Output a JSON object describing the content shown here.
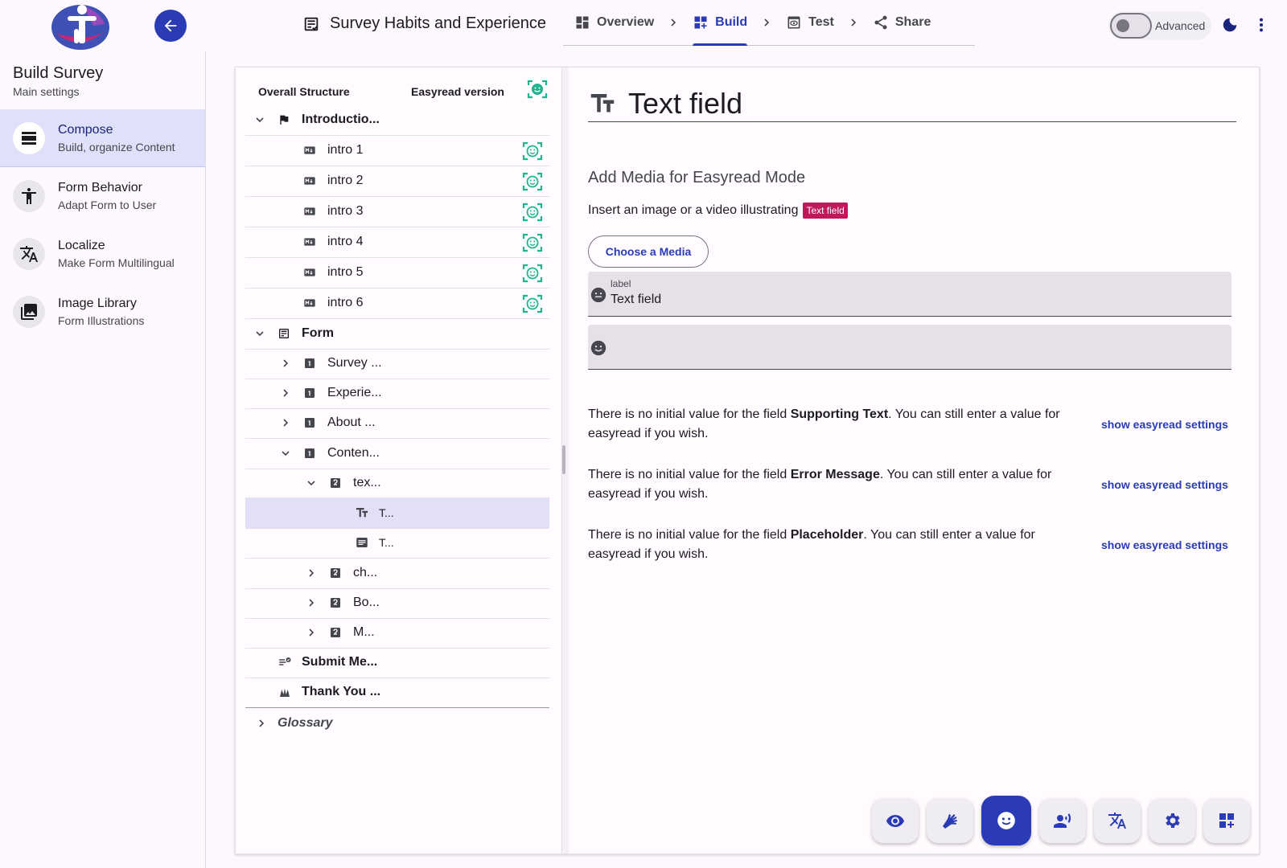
{
  "header": {
    "app_title": "Survey Habits and Experience",
    "steps": [
      {
        "label": "Overview",
        "icon": "dashboard-icon"
      },
      {
        "label": "Build",
        "icon": "build-grid-icon"
      },
      {
        "label": "Test",
        "icon": "preview-icon"
      },
      {
        "label": "Share",
        "icon": "share-icon"
      }
    ],
    "active_step": "Build",
    "advanced_label": "Advanced",
    "advanced_on": false
  },
  "sidebar": {
    "title": "Build Survey",
    "subtitle": "Main settings",
    "items": [
      {
        "label": "Compose",
        "desc": "Build, organize Content",
        "icon": "compose-icon",
        "active": true
      },
      {
        "label": "Form Behavior",
        "desc": "Adapt Form to User",
        "icon": "accessibility-icon",
        "active": false
      },
      {
        "label": "Localize",
        "desc": "Make Form Multilingual",
        "icon": "translate-icon",
        "active": false
      },
      {
        "label": "Image Library",
        "desc": "Form Illustrations",
        "icon": "image-library-icon",
        "active": false
      }
    ]
  },
  "tree": {
    "head_structure": "Overall Structure",
    "head_easyread": "Easyread version",
    "rows": [
      {
        "label": "Introductio...",
        "expander": "open",
        "icon": "flag-icon",
        "bold": true,
        "easyread": false
      },
      {
        "label": "intro 1",
        "expander": "none",
        "icon": "markdown-icon",
        "bold": false,
        "easyread": true
      },
      {
        "label": "intro 2",
        "expander": "none",
        "icon": "markdown-icon",
        "bold": false,
        "easyread": true
      },
      {
        "label": "intro 3",
        "expander": "none",
        "icon": "markdown-icon",
        "bold": false,
        "easyread": true
      },
      {
        "label": "intro 4",
        "expander": "none",
        "icon": "markdown-icon",
        "bold": false,
        "easyread": true
      },
      {
        "label": "intro 5",
        "expander": "none",
        "icon": "markdown-icon",
        "bold": false,
        "easyread": true
      },
      {
        "label": "intro 6",
        "expander": "none",
        "icon": "markdown-icon",
        "bold": false,
        "easyread": true
      },
      {
        "label": "Form",
        "expander": "open",
        "icon": "form-icon",
        "bold": true,
        "easyread": false
      },
      {
        "label": "Survey ...",
        "expander": "closed",
        "icon": "page-1-icon",
        "bold": false,
        "easyread": false
      },
      {
        "label": "Experie...",
        "expander": "closed",
        "icon": "page-1-icon",
        "bold": false,
        "easyread": false
      },
      {
        "label": "About ...",
        "expander": "closed",
        "icon": "page-1-icon",
        "bold": false,
        "easyread": false
      },
      {
        "label": "Conten...",
        "expander": "open",
        "icon": "page-1-icon",
        "bold": false,
        "easyread": false
      },
      {
        "label": "tex...",
        "expander": "open",
        "icon": "section-2-icon",
        "bold": false,
        "easyread": false
      },
      {
        "label": "T...",
        "expander": "none",
        "icon": "text-field-icon",
        "bold": false,
        "easyread": false,
        "selected": true
      },
      {
        "label": "T...",
        "expander": "none",
        "icon": "text-area-icon",
        "bold": false,
        "easyread": false
      },
      {
        "label": "ch...",
        "expander": "closed",
        "icon": "section-2-icon",
        "bold": false,
        "easyread": false
      },
      {
        "label": "Bo...",
        "expander": "closed",
        "icon": "section-2-icon",
        "bold": false,
        "easyread": false
      },
      {
        "label": "M...",
        "expander": "closed",
        "icon": "section-2-icon",
        "bold": false,
        "easyread": false
      },
      {
        "label": "Submit Me...",
        "expander": "none",
        "icon": "submit-message-icon",
        "bold": true,
        "easyread": false
      },
      {
        "label": "Thank You ...",
        "expander": "none",
        "icon": "thank-you-icon",
        "bold": true,
        "easyread": false
      }
    ],
    "glossary": "Glossary"
  },
  "editor": {
    "field_title": "Text field",
    "media_section_title": "Add Media for Easyread Mode",
    "insert_text": "Insert an image or a video illustrating",
    "insert_tag": "Text field",
    "choose_media": "Choose a Media",
    "label_field": {
      "label": "label",
      "value": "Text field"
    },
    "second_field": {
      "value": ""
    },
    "infos": [
      {
        "pre": "There is no initial value for the field ",
        "field": "Supporting Text",
        "post": ". You can still enter a value for easyread if you wish.",
        "link": "show easyread settings"
      },
      {
        "pre": "There is no initial value for the field ",
        "field": "Error Message",
        "post": ". You can still enter a value for easyread if you wish.",
        "link": "show easyread settings"
      },
      {
        "pre": "There is no initial value for the field ",
        "field": "Placeholder",
        "post": ". You can still enter a value for easyread if you wish.",
        "link": "show easyread settings"
      }
    ]
  },
  "toolbar": {
    "buttons": [
      {
        "icon": "eye-icon",
        "active": false
      },
      {
        "icon": "sign-language-icon",
        "active": false
      },
      {
        "icon": "easyread-smiley-icon",
        "active": true
      },
      {
        "icon": "voice-icon",
        "active": false
      },
      {
        "icon": "translate-icon",
        "active": false
      },
      {
        "icon": "settings-gear-icon",
        "active": false
      },
      {
        "icon": "add-widget-icon",
        "active": false
      }
    ]
  },
  "colors": {
    "primary": "#2a3bb5",
    "easyread_green": "#1fb58f",
    "tag_pink": "#c2185b",
    "selected_row": "#e1e0f7",
    "sidebar_active": "#dfe0fa"
  }
}
